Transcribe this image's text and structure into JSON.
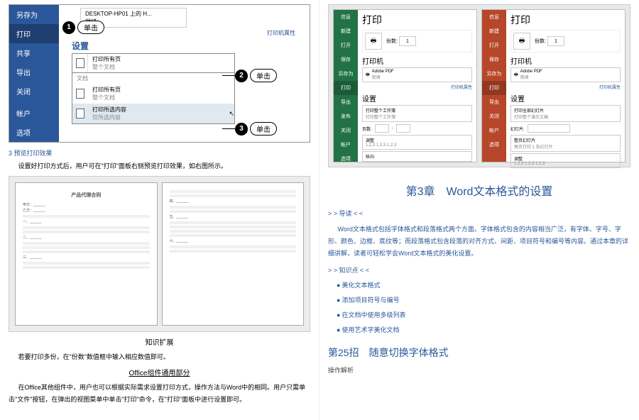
{
  "left": {
    "sidebar": [
      "另存为",
      "打印",
      "共享",
      "导出",
      "关闭",
      "帐户",
      "选项"
    ],
    "active_sidebar_idx": 1,
    "callouts": [
      "单击",
      "单击",
      "单击"
    ],
    "printer": {
      "name": "DESKTOP-HP01 上的 H...",
      "status": "就绪",
      "props": "打印机属性"
    },
    "settings_label": "设置",
    "main_dd": {
      "title": "打印所有页",
      "sub": "整个文档"
    },
    "dd_section": "文档",
    "dd_items": [
      {
        "title": "打印所有页",
        "sub": "整个文档"
      },
      {
        "title": "打印所选内容",
        "sub": "仅所选内容",
        "hover": true
      }
    ],
    "section3": "3  预览打印效果",
    "text1": "设置好打印方式后，用户可在\"打印\"面板右侧预览打印效果，如右图所示。",
    "preview_doc_title": "产品代理合同",
    "heading1": "知识扩展",
    "text2": "若要打印多份，在\"份数\"数值框中输入相应数值即可。",
    "heading2": "Office组件通用部分",
    "text3": "在Office其他组件中，用户也可以根据实际需求设置打印方式，操作方法与Word中的相同。用户只需单击\"文件\"按钮，在弹出的视图菜单中单击\"打印\"命令，在\"打印\"面板中进行设置即可。"
  },
  "right": {
    "apps": [
      {
        "color": "green",
        "title": "打印",
        "side": [
          "信息",
          "新建",
          "打开",
          "保存",
          "另存为",
          "打印",
          "导出",
          "发布",
          "关闭",
          "帐户",
          "选项"
        ],
        "active_idx": 5,
        "copies_label": "份数:",
        "copies": "1",
        "printer_h": "打印机",
        "printer": "Adobe PDF",
        "printer_status": "就绪",
        "printer_props": "打印机属性",
        "settings_h": "设置",
        "opts": [
          {
            "t": "打印整个工作簿",
            "s": "打印整个工作簿"
          },
          {
            "t": "页数:",
            "inputs": true
          },
          {
            "t": "调整",
            "s": "1,2,3  1,2,3  1,2,3"
          },
          {
            "t": "纵向"
          }
        ]
      },
      {
        "color": "red",
        "title": "打印",
        "side": [
          "信息",
          "新建",
          "打开",
          "保存",
          "另存为",
          "打印",
          "导出",
          "关闭",
          "帐户",
          "选项"
        ],
        "active_idx": 5,
        "copies_label": "份数:",
        "copies": "1",
        "printer_h": "打印机",
        "printer": "Adobe PDF",
        "printer_status": "就绪",
        "printer_props": "打印机属性",
        "settings_h": "设置",
        "opts": [
          {
            "t": "打印全部幻灯片",
            "s": "打印整个演示文稿"
          },
          {
            "t": "幻灯片:",
            "inputs": false
          },
          {
            "t": "整页幻灯片",
            "s": "每页打印 1 张幻灯片"
          },
          {
            "t": "调整",
            "s": "1,2,3  1,2,3  1,2,3"
          }
        ]
      }
    ],
    "chapter": "第3章　Word文本格式的设置",
    "nav1": "> > 导读 < <",
    "intro": "Word文本格式包括字体格式和段落格式两个方面。字体格式包含的内容相当广泛，有字体、字号、字形、颜色、边框、底纹等；而段落格式包含段落的对齐方式、间距、项目符号和编号等内容。通过本章的详细讲解，读者可轻松学会Word文本格式的美化设置。",
    "nav2": "> > 知识点 < <",
    "bullets": [
      "美化文本格式",
      "添加项目符号与编号",
      "在文档中使用多级列表",
      "使用艺术字美化文档"
    ],
    "trick": "第25招　随意切换字体格式",
    "trick_sub": "操作解析"
  }
}
